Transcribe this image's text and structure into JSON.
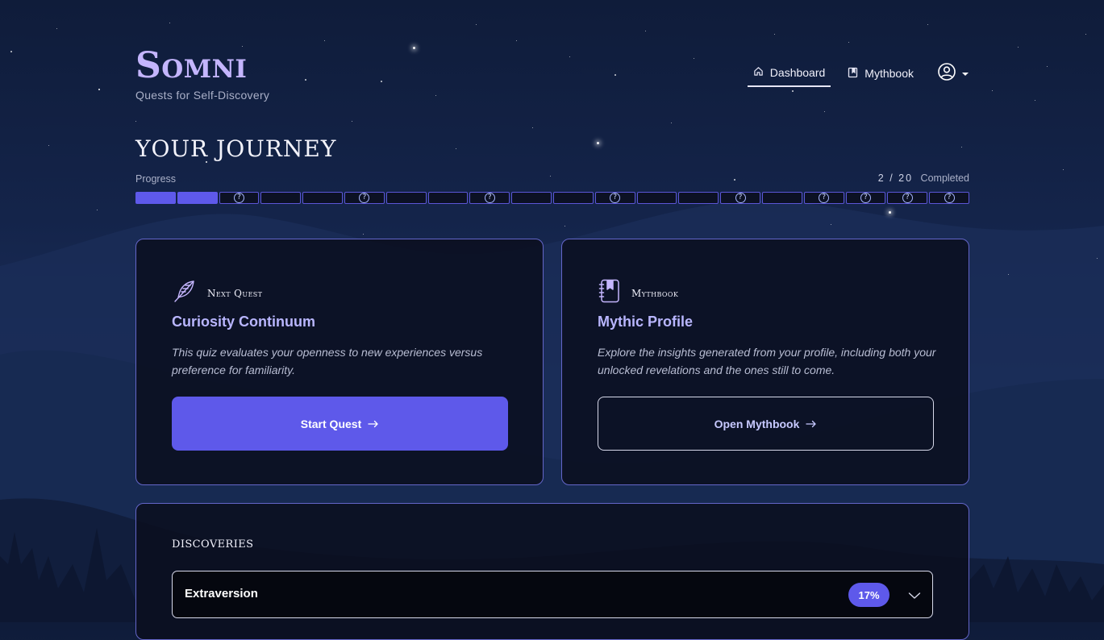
{
  "brand": {
    "name": "Somni",
    "tagline": "Quests for Self-Discovery"
  },
  "nav": {
    "dashboard": {
      "label": "Dashboard",
      "icon": "home-icon",
      "active": true
    },
    "mythbook": {
      "label": "Mythbook",
      "icon": "book-icon"
    },
    "user_menu": {
      "icon": "user-circle-icon",
      "caret": "chevron-down-icon"
    }
  },
  "journey": {
    "title": "YOUR JOURNEY",
    "progress_label": "Progress",
    "completed_count": 2,
    "total_count": 20,
    "count_text": "2 / 20",
    "completed_label": "Completed",
    "segments": [
      {
        "state": "done",
        "mark": ""
      },
      {
        "state": "done",
        "mark": ""
      },
      {
        "state": "locked",
        "mark": "?"
      },
      {
        "state": "pending",
        "mark": ""
      },
      {
        "state": "pending",
        "mark": ""
      },
      {
        "state": "locked",
        "mark": "?"
      },
      {
        "state": "pending",
        "mark": ""
      },
      {
        "state": "pending",
        "mark": ""
      },
      {
        "state": "locked",
        "mark": "?"
      },
      {
        "state": "pending",
        "mark": ""
      },
      {
        "state": "pending",
        "mark": ""
      },
      {
        "state": "locked",
        "mark": "?"
      },
      {
        "state": "pending",
        "mark": ""
      },
      {
        "state": "pending",
        "mark": ""
      },
      {
        "state": "locked",
        "mark": "?"
      },
      {
        "state": "pending",
        "mark": ""
      },
      {
        "state": "locked",
        "mark": "?"
      },
      {
        "state": "locked",
        "mark": "?"
      },
      {
        "state": "locked",
        "mark": "?"
      },
      {
        "state": "locked",
        "mark": "?"
      }
    ]
  },
  "next_quest": {
    "eyebrow": "Next Quest",
    "icon": "feather-icon",
    "title": "Curiosity Continuum",
    "description": "This quiz evaluates your openness to new experiences versus preference for familiarity.",
    "button_label": "Start Quest",
    "button_icon": "arrow-right-icon"
  },
  "mythbook": {
    "eyebrow": "Mythbook",
    "icon": "notebook-icon",
    "title": "Mythic Profile",
    "description": "Explore the insights generated from your profile, including both your unlocked revelations and the ones still to come.",
    "button_label": "Open Mythbook",
    "button_icon": "arrow-right-icon"
  },
  "discoveries": {
    "title": "DISCOVERIES",
    "items": [
      {
        "label": "Extraversion",
        "percent": 17,
        "percent_text": "17%",
        "expand_icon": "chevron-down-icon"
      }
    ]
  },
  "colors": {
    "accent": "#5e59ea",
    "title_lavender": "#b9b6ff",
    "logo_lavender": "#c4b5fd",
    "card_border": "#6466c9",
    "background": "#14244a"
  }
}
